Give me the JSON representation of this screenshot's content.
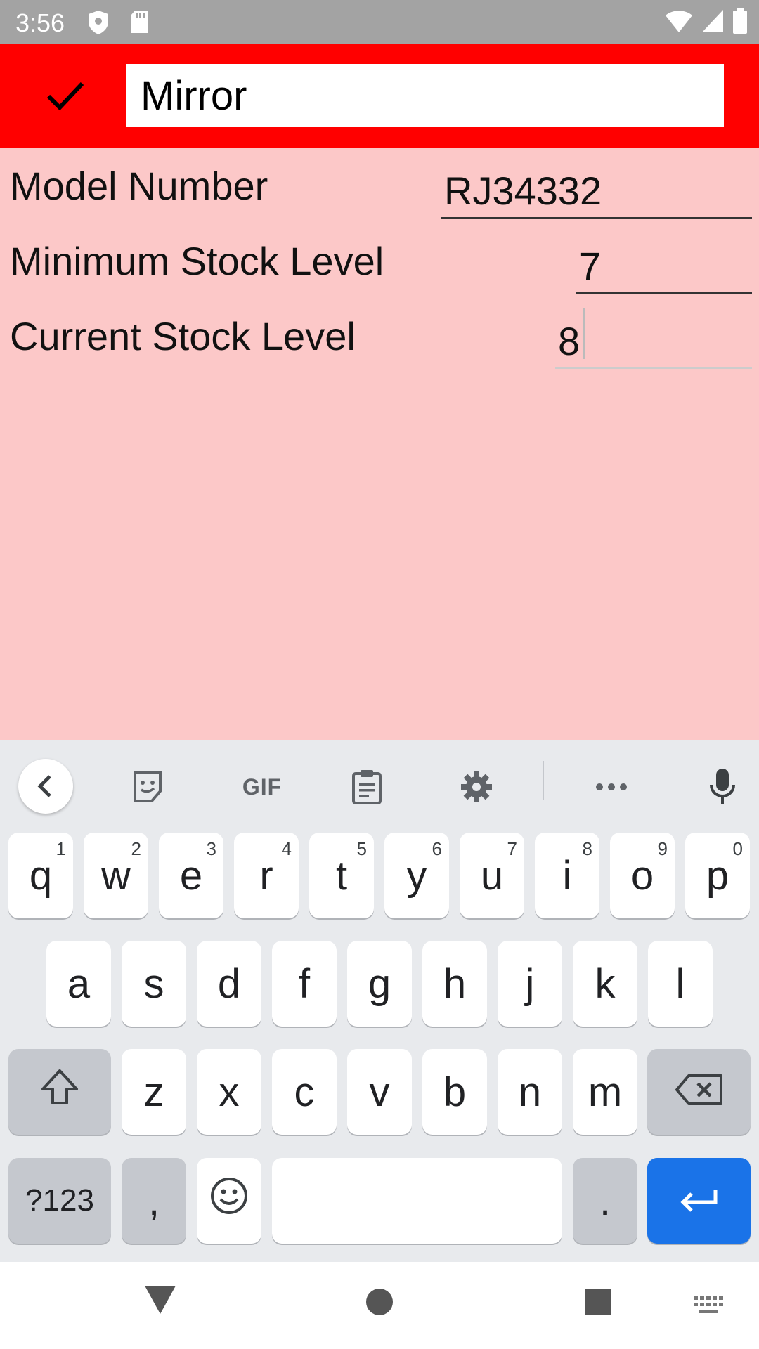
{
  "status_bar": {
    "time": "3:56",
    "icons": [
      "shield-icon",
      "sd-card-icon",
      "wifi-icon",
      "signal-icon",
      "battery-icon"
    ]
  },
  "app_bar": {
    "background": "#ff0000",
    "confirm_icon": "check-icon",
    "name_value": "Mirror"
  },
  "form": {
    "model_number": {
      "label": "Model Number",
      "value": "RJ34332"
    },
    "minimum_stock": {
      "label": "Minimum Stock Level",
      "value": "7"
    },
    "current_stock": {
      "label": "Current Stock Level",
      "value": "8"
    }
  },
  "keyboard": {
    "toolbar": [
      "back-arrow-icon",
      "sticker-icon",
      "gif-icon",
      "clipboard-icon",
      "settings-icon",
      "more-icon",
      "mic-icon"
    ],
    "gif_label": "GIF",
    "row1": [
      {
        "key": "q",
        "hint": "1"
      },
      {
        "key": "w",
        "hint": "2"
      },
      {
        "key": "e",
        "hint": "3"
      },
      {
        "key": "r",
        "hint": "4"
      },
      {
        "key": "t",
        "hint": "5"
      },
      {
        "key": "y",
        "hint": "6"
      },
      {
        "key": "u",
        "hint": "7"
      },
      {
        "key": "i",
        "hint": "8"
      },
      {
        "key": "o",
        "hint": "9"
      },
      {
        "key": "p",
        "hint": "0"
      }
    ],
    "row2": [
      "a",
      "s",
      "d",
      "f",
      "g",
      "h",
      "j",
      "k",
      "l"
    ],
    "row3": [
      "z",
      "x",
      "c",
      "v",
      "b",
      "n",
      "m"
    ],
    "row4": {
      "symbols": "?123",
      "comma": ",",
      "period": "."
    },
    "accent": "#1a73e8"
  },
  "nav_bar": [
    "back-icon",
    "home-icon",
    "recents-icon",
    "keyboard-switch-icon"
  ]
}
